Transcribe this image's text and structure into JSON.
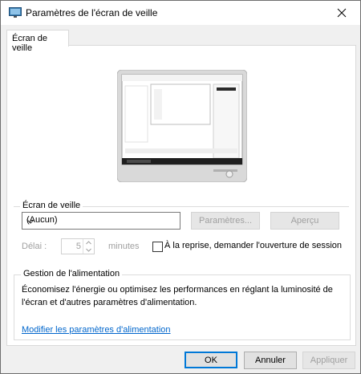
{
  "window": {
    "title": "Paramètres de l'écran de veille"
  },
  "tabs": [
    {
      "label": "Écran de veille"
    }
  ],
  "screensaver": {
    "group_label": "Écran de veille",
    "selected": "(Aucun)",
    "settings_label": "Paramètres...",
    "preview_label": "Aperçu",
    "delay_label": "Délai :",
    "delay_value": "5",
    "delay_unit": "minutes",
    "resume_label": "À la reprise, demander l'ouverture de session"
  },
  "power": {
    "group_label": "Gestion de l'alimentation",
    "description": "Économisez l'énergie ou optimisez les performances en réglant la luminosité de l'écran et d'autres paramètres d'alimentation.",
    "link": "Modifier les paramètres d'alimentation"
  },
  "footer": {
    "ok_label": "OK",
    "cancel_label": "Annuler",
    "apply_label": "Appliquer"
  },
  "colors": {
    "accent": "#0078d7",
    "link": "#0066cc",
    "disabled": "#a0a0a0"
  }
}
